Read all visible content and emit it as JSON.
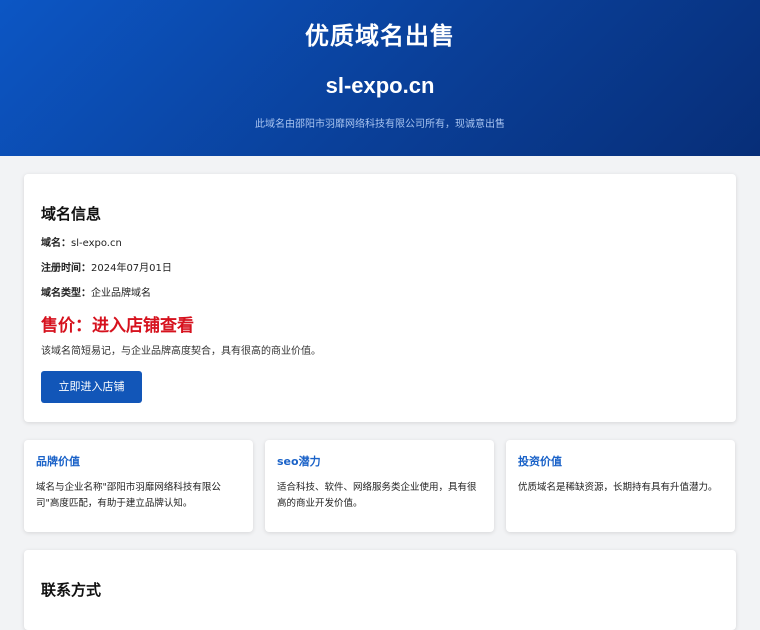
{
  "hero": {
    "title": "优质域名出售",
    "domain": "sl-expo.cn",
    "subtitle": "此域名由邵阳市羽靡网络科技有限公司所有，现诚意出售"
  },
  "info": {
    "heading": "域名信息",
    "rows": [
      {
        "label": "域名：",
        "value": "sl-expo.cn"
      },
      {
        "label": "注册时间：",
        "value": "2024年07月01日"
      },
      {
        "label": "域名类型：",
        "value": "企业品牌域名"
      }
    ],
    "price": "售价：进入店铺查看",
    "description": "该域名简短易记，与企业品牌高度契合，具有很高的商业价值。",
    "button_label": "立即进入店铺"
  },
  "features": [
    {
      "title": "品牌价值",
      "text": "域名与企业名称\"邵阳市羽靡网络科技有限公司\"高度匹配，有助于建立品牌认知。"
    },
    {
      "title": "seo潜力",
      "text": "适合科技、软件、网络服务类企业使用，具有很高的商业开发价值。"
    },
    {
      "title": "投资价值",
      "text": "优质域名是稀缺资源，长期持有具有升值潜力。"
    }
  ],
  "contact": {
    "heading": "联系方式"
  },
  "colors": {
    "hero_gradient_start": "#0c56c4",
    "hero_gradient_end": "#072e78",
    "price_red": "#d6121e",
    "accent_blue": "#1a62c8",
    "button_blue": "#1256b8"
  }
}
